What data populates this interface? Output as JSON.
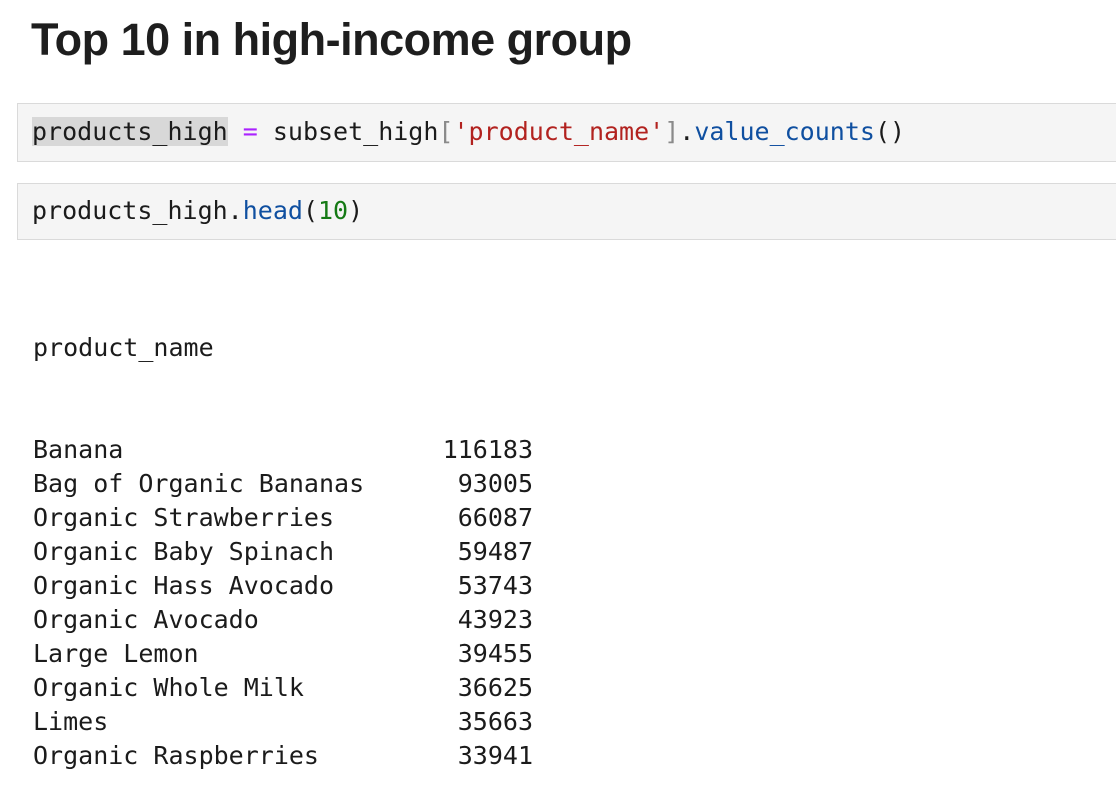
{
  "heading": "Top 10 in high-income group",
  "cells": [
    {
      "tokens": [
        {
          "text": "products_high",
          "kind": "selected"
        },
        {
          "text": " ",
          "kind": "plain"
        },
        {
          "text": "=",
          "kind": "op"
        },
        {
          "text": " subset_high",
          "kind": "plain"
        },
        {
          "text": "[",
          "kind": "bracket"
        },
        {
          "text": "'product_name'",
          "kind": "str"
        },
        {
          "text": "]",
          "kind": "bracket"
        },
        {
          "text": ".",
          "kind": "plain"
        },
        {
          "text": "value_counts",
          "kind": "method"
        },
        {
          "text": "()",
          "kind": "plain"
        }
      ]
    },
    {
      "tokens": [
        {
          "text": "products_high.",
          "kind": "plain"
        },
        {
          "text": "head",
          "kind": "method"
        },
        {
          "text": "(",
          "kind": "plain"
        },
        {
          "text": "10",
          "kind": "num"
        },
        {
          "text": ")",
          "kind": "plain"
        }
      ]
    }
  ],
  "output": {
    "header": "product_name",
    "rows": [
      {
        "name": "Banana",
        "count": "116183"
      },
      {
        "name": "Bag of Organic Bananas",
        "count": "93005"
      },
      {
        "name": "Organic Strawberries",
        "count": "66087"
      },
      {
        "name": "Organic Baby Spinach",
        "count": "59487"
      },
      {
        "name": "Organic Hass Avocado",
        "count": "53743"
      },
      {
        "name": "Organic Avocado",
        "count": "43923"
      },
      {
        "name": "Large Lemon",
        "count": "39455"
      },
      {
        "name": "Organic Whole Milk",
        "count": "36625"
      },
      {
        "name": "Limes",
        "count": "35663"
      },
      {
        "name": "Organic Raspberries",
        "count": "33941"
      }
    ]
  },
  "colors": {
    "operator": "#aa22ff",
    "string": "#b2221f",
    "method": "#0f4fa0",
    "number": "#157a15",
    "cell_background": "#f5f5f5"
  }
}
